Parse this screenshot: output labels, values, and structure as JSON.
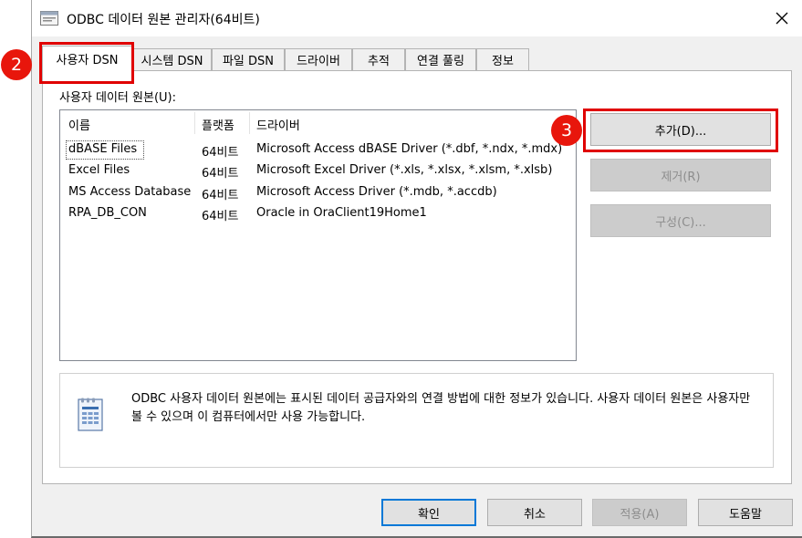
{
  "window": {
    "title": "ODBC 데이터 원본 관리자(64비트)",
    "close_icon": "close-icon"
  },
  "tabs": [
    {
      "label": "사용자 DSN",
      "active": true
    },
    {
      "label": "시스템 DSN",
      "active": false
    },
    {
      "label": "파일 DSN",
      "active": false
    },
    {
      "label": "드라이버",
      "active": false
    },
    {
      "label": "추적",
      "active": false
    },
    {
      "label": "연결 풀링",
      "active": false
    },
    {
      "label": "정보",
      "active": false
    }
  ],
  "panel": {
    "group_label": "사용자 데이터 원본(U):",
    "columns": [
      "이름",
      "플랫폼",
      "드라이버"
    ],
    "rows": [
      {
        "name": "dBASE Files",
        "platform": "64비트",
        "driver": "Microsoft Access dBASE Driver (*.dbf, *.ndx, *.mdx)"
      },
      {
        "name": "Excel Files",
        "platform": "64비트",
        "driver": "Microsoft Excel Driver (*.xls, *.xlsx, *.xlsm, *.xlsb)"
      },
      {
        "name": "MS Access Database",
        "platform": "64비트",
        "driver": "Microsoft Access Driver (*.mdb, *.accdb)"
      },
      {
        "name": "RPA_DB_CON",
        "platform": "64비트",
        "driver": "Oracle in OraClient19Home1"
      }
    ],
    "buttons": {
      "add": "추가(D)...",
      "remove": "제거(R)",
      "configure": "구성(C)..."
    },
    "info_text": "ODBC 사용자 데이터 원본에는 표시된 데이터 공급자와의 연결 방법에 대한 정보가 있습니다. 사용자 데이터 원본은 사용자만 볼 수 있으며 이 컴퓨터에서만 사용 가능합니다."
  },
  "footer": {
    "ok": "확인",
    "cancel": "취소",
    "apply": "적용(A)",
    "help": "도움말"
  },
  "annotations": {
    "step_2": "2",
    "step_3": "3",
    "highlight_color": "#e00000"
  }
}
